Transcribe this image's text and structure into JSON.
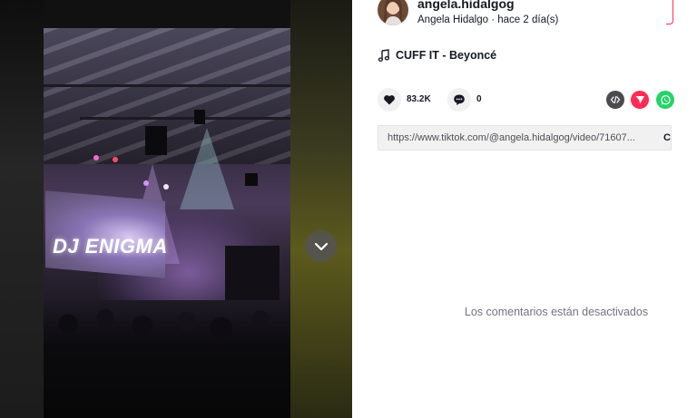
{
  "video": {
    "screen_text": "DJ ENIGMA"
  },
  "author": {
    "username": "angela.hidalgog",
    "display_name": "Angela Hidalgo",
    "separator": " · ",
    "posted": "hace 2 día(s)"
  },
  "music": {
    "title": "CUFF IT - Beyoncé",
    "icon": "music-note-icon"
  },
  "actions": {
    "likes": "83.2K",
    "comments": "0"
  },
  "share": {
    "icons": [
      "embed-icon",
      "send-icon",
      "whatsapp-icon"
    ]
  },
  "link": {
    "url": "https://www.tiktok.com/@angela.hidalgog/video/71607...",
    "copy_label": "Copiar enlace"
  },
  "comments_status": "Los comentarios están desactivados",
  "colors": {
    "brand": "#fe2c55",
    "whatsapp": "#25d366",
    "text": "#161823",
    "muted": "#73747b"
  }
}
